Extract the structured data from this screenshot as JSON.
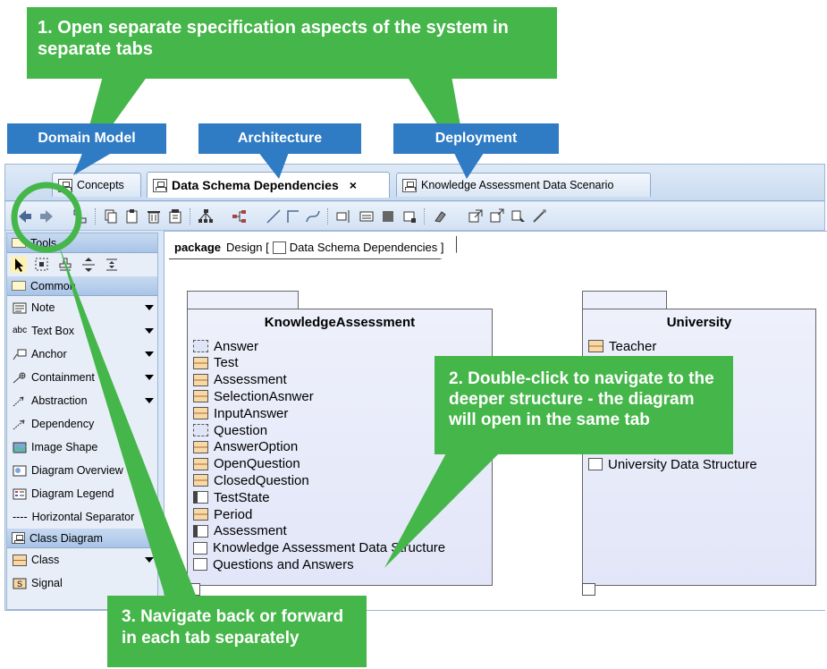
{
  "callouts": {
    "c1": {
      "num": "1.",
      "text": "Open separate specification aspects of the system in separate tabs"
    },
    "c2": {
      "num": "2.",
      "text": "Double-click to navigate to the deeper structure - the diagram will open in the same tab"
    },
    "c3": {
      "num": "3.",
      "text": "Navigate back or forward in each tab separately"
    },
    "domain_model": "Domain Model",
    "architecture": "Architecture",
    "deployment": "Deployment"
  },
  "tabs": [
    {
      "label": "Concepts"
    },
    {
      "label": "Data Schema Dependencies",
      "close": "×"
    },
    {
      "label": "Knowledge Assessment Data Scenario"
    }
  ],
  "palette": {
    "tools_header": "Tools",
    "common_header": "Common",
    "items": [
      "Note",
      "Text Box",
      "Anchor",
      "Containment",
      "Abstraction",
      "Dependency",
      "Image Shape",
      "Diagram Overview",
      "Diagram Legend",
      "Horizontal Separator"
    ],
    "textbox_prefix": "abc",
    "separator_prefix": "----",
    "class_header": "Class Diagram",
    "class_items": [
      "Class",
      "Signal"
    ]
  },
  "diagram": {
    "frame_keyword": "package",
    "frame_name": "Design [",
    "frame_diagram": "Data Schema Dependencies ]",
    "pkg1": {
      "title": "KnowledgeAssessment",
      "elements": [
        {
          "name": "Answer",
          "kind": "sig"
        },
        {
          "name": "Test",
          "kind": "class"
        },
        {
          "name": "Assessment",
          "kind": "class"
        },
        {
          "name": "SelectionAsnwer",
          "kind": "class"
        },
        {
          "name": "InputAnswer",
          "kind": "class"
        },
        {
          "name": "Question",
          "kind": "sig"
        },
        {
          "name": "AnswerOption",
          "kind": "class"
        },
        {
          "name": "OpenQuestion",
          "kind": "class"
        },
        {
          "name": "ClosedQuestion",
          "kind": "class"
        },
        {
          "name": "TestState",
          "kind": "enum"
        },
        {
          "name": "Period",
          "kind": "class"
        },
        {
          "name": "Assessment",
          "kind": "enum"
        },
        {
          "name": "Knowledge Assessment Data Structure",
          "kind": "pkg"
        },
        {
          "name": "Questions and Answers",
          "kind": "pkg"
        }
      ]
    },
    "pkg2": {
      "title": "University",
      "elements": [
        {
          "name": "Teacher",
          "kind": "class"
        },
        {
          "name": "University Data Structure",
          "kind": "pkg"
        }
      ]
    }
  },
  "colors": {
    "green": "#45b649",
    "blue": "#2f7bc4"
  }
}
